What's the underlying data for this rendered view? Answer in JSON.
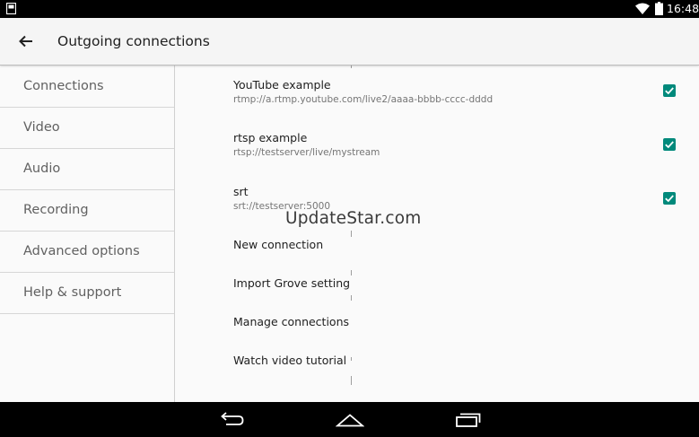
{
  "status_bar": {
    "time": "16:48",
    "icons": [
      "notification-icon",
      "wifi-icon",
      "battery-icon"
    ]
  },
  "app_bar": {
    "title": "Outgoing connections",
    "back_icon": "arrow-back-icon"
  },
  "sidebar": {
    "items": [
      {
        "label": "Connections"
      },
      {
        "label": "Video"
      },
      {
        "label": "Audio"
      },
      {
        "label": "Recording"
      },
      {
        "label": "Advanced options"
      },
      {
        "label": "Help & support"
      }
    ]
  },
  "connections": [
    {
      "name": "YouTube example",
      "url": "rtmp://a.rtmp.youtube.com/live2/aaaa-bbbb-cccc-dddd",
      "checked": true
    },
    {
      "name": "rtsp example",
      "url": "rtsp://testserver/live/mystream",
      "checked": true
    },
    {
      "name": "srt",
      "url": "srt://testserver:5000",
      "checked": true
    }
  ],
  "actions": [
    {
      "label": "New connection"
    },
    {
      "label": "Import Grove setting"
    },
    {
      "label": "Manage connections"
    },
    {
      "label": "Watch video tutorial"
    }
  ],
  "watermark": "UpdateStar.com",
  "nav_bar": {
    "icons": [
      "back-nav-icon",
      "home-nav-icon",
      "recents-nav-icon"
    ]
  },
  "colors": {
    "accent": "#00897b",
    "status_bar": "#000000",
    "app_bar": "#f5f5f5"
  }
}
